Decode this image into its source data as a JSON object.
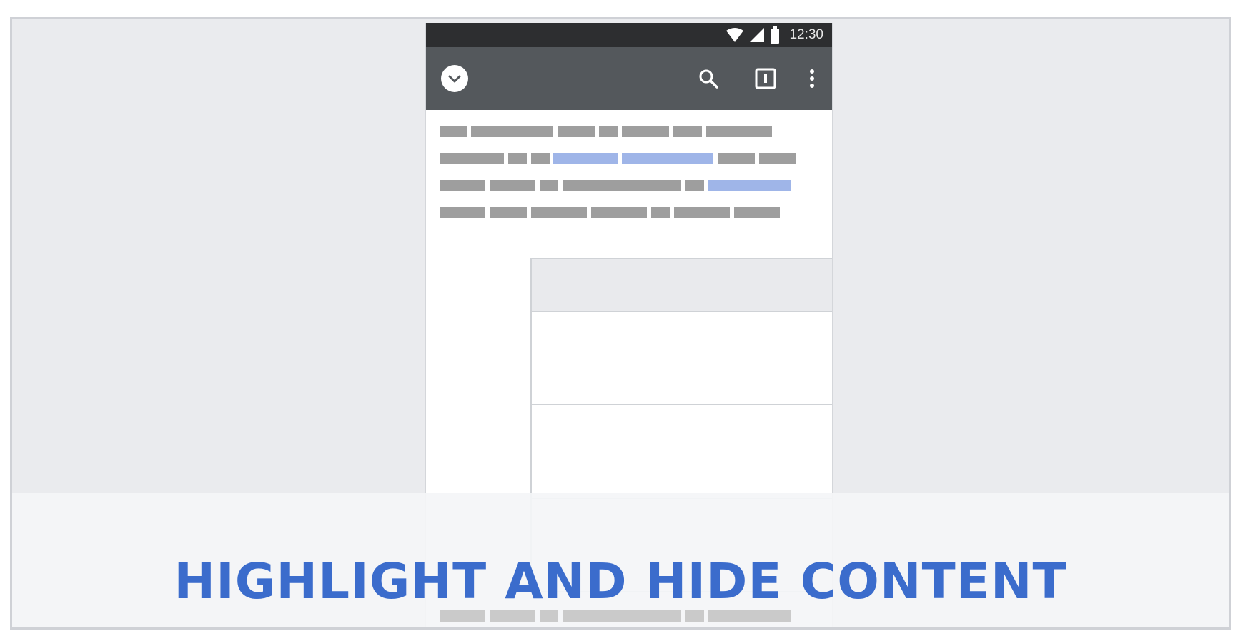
{
  "status_bar": {
    "time": "12:30",
    "icons": [
      "wifi-icon",
      "cell-signal-icon",
      "battery-icon"
    ]
  },
  "toolbar": {
    "icons": [
      "chevron-down-circle-icon",
      "search-icon",
      "tab-switcher-icon",
      "overflow-menu-icon"
    ]
  },
  "banner": {
    "title": "HIGHLIGHT AND HIDE CONTENT"
  },
  "colors": {
    "status_bar": "#2d2e30",
    "toolbar": "#54585c",
    "text_placeholder": "#9e9e9e",
    "link_placeholder": "#9fb5e8",
    "title": "#3b6ccc",
    "background": "#eaebee"
  }
}
